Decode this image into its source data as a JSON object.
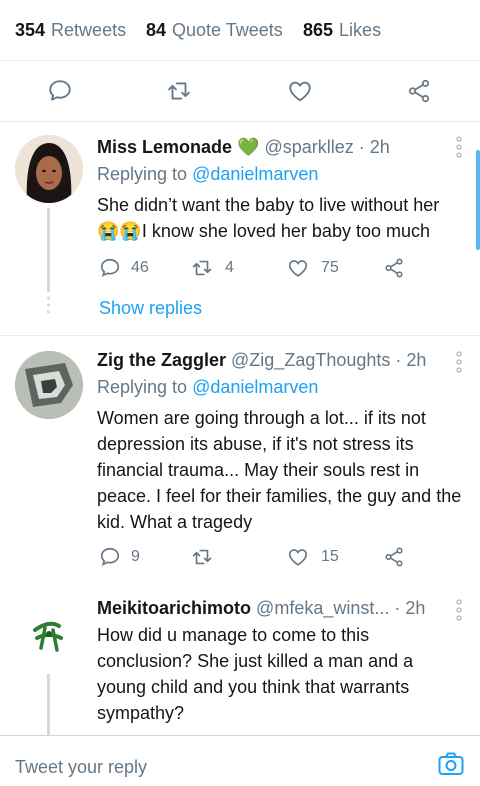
{
  "stats": [
    {
      "count": "354",
      "label": "Retweets"
    },
    {
      "count": "84",
      "label": "Quote Tweets"
    },
    {
      "count": "865",
      "label": "Likes"
    }
  ],
  "action_icons": [
    "reply-icon",
    "retweet-icon",
    "like-icon",
    "share-icon"
  ],
  "tweets": [
    {
      "name": "Miss Lemonade",
      "badge": "💚",
      "handle": "@sparkllez",
      "sep": " · ",
      "time": "2h",
      "replying_prefix": "Replying to ",
      "replying_to": "@danielmarven",
      "text_line1": "She didn’t want the baby to live without her",
      "emoji": "😭😭",
      "text_line2": "I know she loved her baby too much",
      "replies": "46",
      "retweets": "4",
      "likes": "75",
      "show_replies": "Show replies"
    },
    {
      "name": "Zig the Zaggler",
      "handle": "@Zig_ZagThoughts",
      "sep": " · ",
      "time": "2h",
      "replying_prefix": "Replying to ",
      "replying_to": "@danielmarven",
      "text": "Women are going through a lot... if its not depression its abuse, if it's not stress its financial trauma... May their souls rest in peace. I feel for their families, the guy and the kid. What a tragedy",
      "replies": "9",
      "retweets": "",
      "likes": "15"
    },
    {
      "name": "Meikitoarichimoto",
      "handle": "@mfeka_winst...",
      "sep": " · ",
      "time": "2h",
      "text": "How did u manage to come to this conclusion? She just killed a man and a young child and you think that warrants sympathy?"
    }
  ],
  "composer": {
    "placeholder": "Tweet your reply"
  },
  "colors": {
    "accent": "#1da1f2",
    "secondary": "#657786",
    "border": "#e6ecf0"
  }
}
